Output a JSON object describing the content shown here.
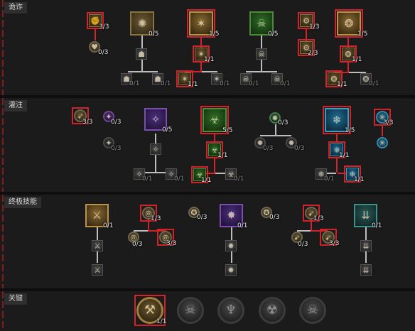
{
  "sections": [
    {
      "label": "诡诈"
    },
    {
      "label": "灌注"
    },
    {
      "label": "终极技能"
    },
    {
      "label": "关键"
    }
  ],
  "nodes": [
    {
      "rank": "3/3",
      "icon": "gauntlet-icon"
    },
    {
      "rank": "0/3",
      "icon": "heart-icon"
    },
    {
      "rank": "0/5",
      "icon": "smoke-bomb-icon"
    },
    {
      "rank": "",
      "icon": "figure-icon"
    },
    {
      "rank": "0/1",
      "icon": "figure-icon"
    },
    {
      "rank": "0/1",
      "icon": "figure-icon"
    },
    {
      "rank": "1/5",
      "icon": "caltrops-icon"
    },
    {
      "rank": "1/1",
      "icon": "caltrops-icon"
    },
    {
      "rank": "1/1",
      "icon": "caltrops-icon"
    },
    {
      "rank": "0/1",
      "icon": "caltrops-icon"
    },
    {
      "rank": "0/5",
      "icon": "poison-trap-icon"
    },
    {
      "rank": "",
      "icon": "skull-icon"
    },
    {
      "rank": "0/1",
      "icon": "skull-icon"
    },
    {
      "rank": "0/1",
      "icon": "skull-icon"
    },
    {
      "rank": "1/3",
      "icon": "trap-icon"
    },
    {
      "rank": "2/3",
      "icon": "trap-icon"
    },
    {
      "rank": "1/5",
      "icon": "dark-shroud-icon"
    },
    {
      "rank": "1/1",
      "icon": "dark-shroud-icon"
    },
    {
      "rank": "1/1",
      "icon": "dark-shroud-icon"
    },
    {
      "rank": "0/1",
      "icon": "dark-shroud-icon"
    },
    {
      "rank": "3/3",
      "icon": "arrow-icon"
    },
    {
      "rank": "0/3",
      "icon": "shadow-icon"
    },
    {
      "rank": "0/3",
      "icon": "shadow-icon"
    },
    {
      "rank": "0/5",
      "icon": "shadow-imbue-icon"
    },
    {
      "rank": "",
      "icon": "shadow-imbue-icon"
    },
    {
      "rank": "0/1",
      "icon": "shadow-imbue-icon"
    },
    {
      "rank": "0/1",
      "icon": "shadow-imbue-icon"
    },
    {
      "rank": "5/5",
      "icon": "poison-imbue-icon"
    },
    {
      "rank": "1/1",
      "icon": "poison-imbue-icon"
    },
    {
      "rank": "1/1",
      "icon": "poison-imbue-icon"
    },
    {
      "rank": "0/1",
      "icon": "poison-imbue-icon"
    },
    {
      "rank": "0/3",
      "icon": "venom-icon"
    },
    {
      "rank": "0/3",
      "icon": "venom-icon"
    },
    {
      "rank": "0/3",
      "icon": "venom-icon"
    },
    {
      "rank": "1/5",
      "icon": "cold-imbue-icon"
    },
    {
      "rank": "1/1",
      "icon": "cold-imbue-icon"
    },
    {
      "rank": "1/1",
      "icon": "cold-imbue-icon"
    },
    {
      "rank": "0/1",
      "icon": "cold-imbue-icon"
    },
    {
      "rank": "3/3",
      "icon": "frost-icon"
    },
    {
      "rank": "",
      "icon": "frost-icon"
    },
    {
      "rank": "0/1",
      "icon": "shadow-clone-icon"
    },
    {
      "rank": "",
      "icon": "shadow-clone-icon"
    },
    {
      "rank": "",
      "icon": "shadow-clone-icon"
    },
    {
      "rank": "1/3",
      "icon": "precision-icon"
    },
    {
      "rank": "0/3",
      "icon": "precision-icon"
    },
    {
      "rank": "3/3",
      "icon": "precision-icon"
    },
    {
      "rank": "0/3",
      "icon": "coin-icon"
    },
    {
      "rank": "0/1",
      "icon": "death-trap-icon"
    },
    {
      "rank": "",
      "icon": "death-trap-icon"
    },
    {
      "rank": "",
      "icon": "death-trap-icon"
    },
    {
      "rank": "0/3",
      "icon": "coin-icon"
    },
    {
      "rank": "1/3",
      "icon": "haste-icon"
    },
    {
      "rank": "0/3",
      "icon": "haste-icon"
    },
    {
      "rank": "3/3",
      "icon": "haste-icon"
    },
    {
      "rank": "0/1",
      "icon": "rain-of-arrows-icon"
    },
    {
      "rank": "",
      "icon": "rain-of-arrows-icon"
    },
    {
      "rank": "",
      "icon": "rain-of-arrows-icon"
    },
    {
      "rank": "1/1",
      "icon": "precision-key-icon"
    },
    {
      "rank": "",
      "icon": "demon-skull-icon"
    },
    {
      "rank": "",
      "icon": "horned-skull-icon"
    },
    {
      "rank": "",
      "icon": "twin-skull-icon"
    },
    {
      "rank": "",
      "icon": "skull-key-icon"
    }
  ]
}
